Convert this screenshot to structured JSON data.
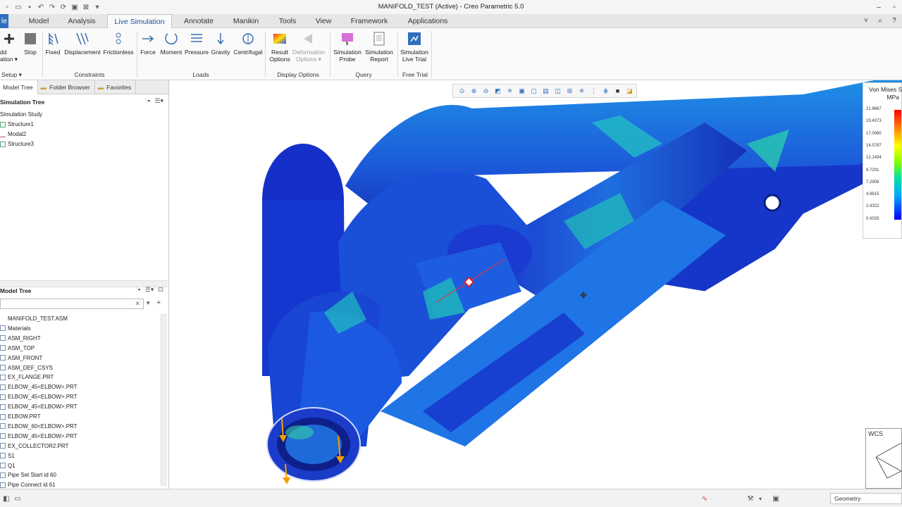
{
  "window": {
    "title": "MANIFOLD_TEST (Active) - Creo Parametric 5.0"
  },
  "tabs": [
    {
      "label": "le"
    },
    {
      "label": "Model"
    },
    {
      "label": "Analysis"
    },
    {
      "label": "Live Simulation"
    },
    {
      "label": "Annotate"
    },
    {
      "label": "Manikin"
    },
    {
      "label": "Tools"
    },
    {
      "label": "View"
    },
    {
      "label": "Framework"
    },
    {
      "label": "Applications"
    }
  ],
  "ribbon": {
    "buttons": [
      {
        "line1": "dd",
        "line2": "ation ▾"
      },
      {
        "line1": "Stop",
        "line2": ""
      },
      {
        "line1": "Fixed",
        "line2": ""
      },
      {
        "line1": "Displacement",
        "line2": ""
      },
      {
        "line1": "Frictionless",
        "line2": ""
      },
      {
        "line1": "Force",
        "line2": ""
      },
      {
        "line1": "Moment",
        "line2": ""
      },
      {
        "line1": "Pressure",
        "line2": ""
      },
      {
        "line1": "Gravity",
        "line2": ""
      },
      {
        "line1": "Centrifugal",
        "line2": ""
      },
      {
        "line1": "Result",
        "line2": "Options"
      },
      {
        "line1": "Deformation",
        "line2": "Options ▾"
      },
      {
        "line1": "Simulation",
        "line2": "Probe"
      },
      {
        "line1": "Simulation",
        "line2": "Report"
      },
      {
        "line1": "Simulation",
        "line2": "Live Trial"
      }
    ],
    "groups": [
      {
        "label": "Setup ▾"
      },
      {
        "label": "Constraints"
      },
      {
        "label": "Loads"
      },
      {
        "label": "Display Options"
      },
      {
        "label": "Query"
      },
      {
        "label": "Free Trial"
      }
    ]
  },
  "navigator": {
    "tabs": [
      "Model Tree",
      "Folder Browser",
      "Favorites"
    ],
    "sim_header": "Simulation Tree",
    "sim_items": [
      "Simulation Study",
      "Structure1",
      "Modal2",
      "Structure3"
    ],
    "model_header": "Model Tree",
    "model_items": [
      "MANIFOLD_TEST.ASM",
      "Materials",
      "ASM_RIGHT",
      "ASM_TOP",
      "ASM_FRONT",
      "ASM_DEF_CSYS",
      "EX_FLANGE.PRT",
      "ELBOW_45<ELBOW>.PRT",
      "ELBOW_45<ELBOW>.PRT",
      "ELBOW_45<ELBOW>.PRT",
      "ELBOW.PRT",
      "ELBOW_60<ELBOW>.PRT",
      "ELBOW_45<ELBOW>.PRT",
      "EX_COLLECTOR2.PRT",
      "S1",
      "Q1",
      "Pipe Set Start id 60",
      "Pipe Connect id 61"
    ]
  },
  "legend": {
    "title": "Von Mises S",
    "unit": "MPa",
    "values": [
      "21.8667",
      "19.4373",
      "17.0080",
      "14.5787",
      "12.1494",
      "9.7201",
      "7.2908",
      "4.8615",
      "2.4322",
      "0.0029"
    ]
  },
  "wcs_label": "WCS",
  "status": {
    "selection_filter": "Geometry"
  },
  "colors": {
    "accent": "#2f6fbd",
    "file_tab": "#2f6fbd"
  }
}
